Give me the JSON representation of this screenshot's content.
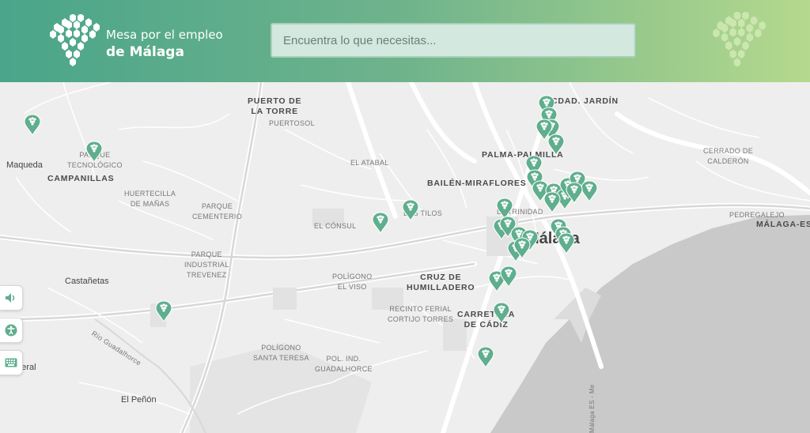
{
  "header": {
    "brand_line1": "Mesa por el empleo",
    "brand_line2": "de Málaga",
    "search_placeholder": "Encuentra lo que necesitas..."
  },
  "colors": {
    "header_start": "#4aa58a",
    "header_end": "#b5d98d",
    "marker": "#5fae8e",
    "sea": "#c8c8c8",
    "land": "#eeeeee"
  },
  "map": {
    "labels": {
      "puerto_torre": "PUERTO DE\nLA TORRE",
      "puertosol": "PUERTOSOL",
      "cdad_jardin": "CDAD. JARDÍN",
      "palma_palmilla": "PALMA-PALMILLA",
      "cerrado": "CERRADO DE\nCALDERÓN",
      "maqueda": "Maqueda",
      "parque_tecnologico": "PARQUE\nTECNOLÓGICO",
      "campanillas": "CAMPANILLAS",
      "el_atabal": "EL ATABAL",
      "bailen": "BAILÉN-MIRAFLORES",
      "huertecilla": "HUERTECILLA\nDE MAÑAS",
      "parque_cementerio": "PARQUE\nCEMENTERIO",
      "los_tilos": "LOS TILOS",
      "la_trinidad": "LA TRINIDAD",
      "pedregalejo": "PEDREGALEJO",
      "malaga_este": "MÁLAGA-ESTE",
      "el_consul": "EL CÓNSUL",
      "malaga": "Málaga",
      "parque_industrial": "PARQUE\nINDUSTRIAL\nTREVENEZ",
      "castanetas": "Castañetas",
      "poligono_viso": "POLÍGONO\nEL VISO",
      "cruz_humilladero": "CRUZ DE\nHUMILLADERO",
      "recinto_ferial": "RECINTO FERIAL\nCORTIJO TORRES",
      "carretera_cadiz": "CARRETERA\nDE CÁDIZ",
      "rio_guadalhorce": "Río Guadalhorce",
      "poligono_santa_teresa": "POLÍGONO\nSANTA TERESA",
      "pol_guadalhorce": "POL. IND.\nGUADALHORCE",
      "romeral": "Romeral",
      "el_penon": "El Peñón",
      "malaga_es": "Málaga ES - Me"
    },
    "marker_count": 34
  },
  "accessibility": {
    "buttons": [
      "speaker-icon",
      "accessibility-icon",
      "keyboard-icon"
    ]
  }
}
